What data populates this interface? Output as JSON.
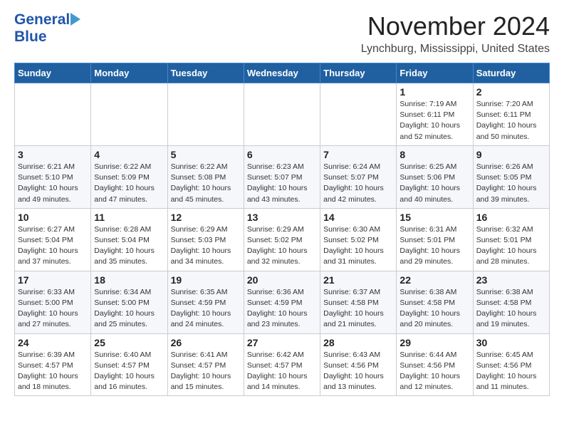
{
  "header": {
    "logo_line1": "General",
    "logo_line2": "Blue",
    "month_title": "November 2024",
    "location": "Lynchburg, Mississippi, United States"
  },
  "weekdays": [
    "Sunday",
    "Monday",
    "Tuesday",
    "Wednesday",
    "Thursday",
    "Friday",
    "Saturday"
  ],
  "weeks": [
    [
      {
        "day": "",
        "info": ""
      },
      {
        "day": "",
        "info": ""
      },
      {
        "day": "",
        "info": ""
      },
      {
        "day": "",
        "info": ""
      },
      {
        "day": "",
        "info": ""
      },
      {
        "day": "1",
        "info": "Sunrise: 7:19 AM\nSunset: 6:11 PM\nDaylight: 10 hours\nand 52 minutes."
      },
      {
        "day": "2",
        "info": "Sunrise: 7:20 AM\nSunset: 6:11 PM\nDaylight: 10 hours\nand 50 minutes."
      }
    ],
    [
      {
        "day": "3",
        "info": "Sunrise: 6:21 AM\nSunset: 5:10 PM\nDaylight: 10 hours\nand 49 minutes."
      },
      {
        "day": "4",
        "info": "Sunrise: 6:22 AM\nSunset: 5:09 PM\nDaylight: 10 hours\nand 47 minutes."
      },
      {
        "day": "5",
        "info": "Sunrise: 6:22 AM\nSunset: 5:08 PM\nDaylight: 10 hours\nand 45 minutes."
      },
      {
        "day": "6",
        "info": "Sunrise: 6:23 AM\nSunset: 5:07 PM\nDaylight: 10 hours\nand 43 minutes."
      },
      {
        "day": "7",
        "info": "Sunrise: 6:24 AM\nSunset: 5:07 PM\nDaylight: 10 hours\nand 42 minutes."
      },
      {
        "day": "8",
        "info": "Sunrise: 6:25 AM\nSunset: 5:06 PM\nDaylight: 10 hours\nand 40 minutes."
      },
      {
        "day": "9",
        "info": "Sunrise: 6:26 AM\nSunset: 5:05 PM\nDaylight: 10 hours\nand 39 minutes."
      }
    ],
    [
      {
        "day": "10",
        "info": "Sunrise: 6:27 AM\nSunset: 5:04 PM\nDaylight: 10 hours\nand 37 minutes."
      },
      {
        "day": "11",
        "info": "Sunrise: 6:28 AM\nSunset: 5:04 PM\nDaylight: 10 hours\nand 35 minutes."
      },
      {
        "day": "12",
        "info": "Sunrise: 6:29 AM\nSunset: 5:03 PM\nDaylight: 10 hours\nand 34 minutes."
      },
      {
        "day": "13",
        "info": "Sunrise: 6:29 AM\nSunset: 5:02 PM\nDaylight: 10 hours\nand 32 minutes."
      },
      {
        "day": "14",
        "info": "Sunrise: 6:30 AM\nSunset: 5:02 PM\nDaylight: 10 hours\nand 31 minutes."
      },
      {
        "day": "15",
        "info": "Sunrise: 6:31 AM\nSunset: 5:01 PM\nDaylight: 10 hours\nand 29 minutes."
      },
      {
        "day": "16",
        "info": "Sunrise: 6:32 AM\nSunset: 5:01 PM\nDaylight: 10 hours\nand 28 minutes."
      }
    ],
    [
      {
        "day": "17",
        "info": "Sunrise: 6:33 AM\nSunset: 5:00 PM\nDaylight: 10 hours\nand 27 minutes."
      },
      {
        "day": "18",
        "info": "Sunrise: 6:34 AM\nSunset: 5:00 PM\nDaylight: 10 hours\nand 25 minutes."
      },
      {
        "day": "19",
        "info": "Sunrise: 6:35 AM\nSunset: 4:59 PM\nDaylight: 10 hours\nand 24 minutes."
      },
      {
        "day": "20",
        "info": "Sunrise: 6:36 AM\nSunset: 4:59 PM\nDaylight: 10 hours\nand 23 minutes."
      },
      {
        "day": "21",
        "info": "Sunrise: 6:37 AM\nSunset: 4:58 PM\nDaylight: 10 hours\nand 21 minutes."
      },
      {
        "day": "22",
        "info": "Sunrise: 6:38 AM\nSunset: 4:58 PM\nDaylight: 10 hours\nand 20 minutes."
      },
      {
        "day": "23",
        "info": "Sunrise: 6:38 AM\nSunset: 4:58 PM\nDaylight: 10 hours\nand 19 minutes."
      }
    ],
    [
      {
        "day": "24",
        "info": "Sunrise: 6:39 AM\nSunset: 4:57 PM\nDaylight: 10 hours\nand 18 minutes."
      },
      {
        "day": "25",
        "info": "Sunrise: 6:40 AM\nSunset: 4:57 PM\nDaylight: 10 hours\nand 16 minutes."
      },
      {
        "day": "26",
        "info": "Sunrise: 6:41 AM\nSunset: 4:57 PM\nDaylight: 10 hours\nand 15 minutes."
      },
      {
        "day": "27",
        "info": "Sunrise: 6:42 AM\nSunset: 4:57 PM\nDaylight: 10 hours\nand 14 minutes."
      },
      {
        "day": "28",
        "info": "Sunrise: 6:43 AM\nSunset: 4:56 PM\nDaylight: 10 hours\nand 13 minutes."
      },
      {
        "day": "29",
        "info": "Sunrise: 6:44 AM\nSunset: 4:56 PM\nDaylight: 10 hours\nand 12 minutes."
      },
      {
        "day": "30",
        "info": "Sunrise: 6:45 AM\nSunset: 4:56 PM\nDaylight: 10 hours\nand 11 minutes."
      }
    ]
  ]
}
